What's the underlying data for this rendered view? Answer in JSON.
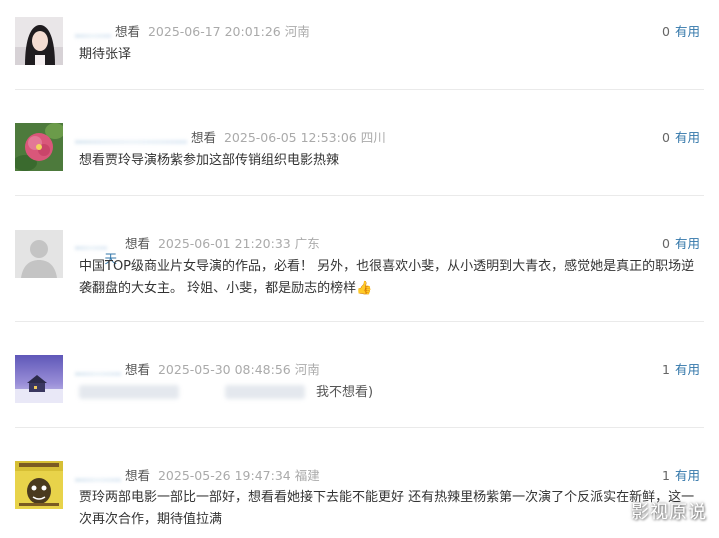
{
  "comments": [
    {
      "username": "",
      "action": "想看",
      "time": "2025-06-17 20:01:26",
      "location": "河南",
      "votes": "0",
      "useful_label": "有用",
      "content": "期待张译"
    },
    {
      "username": "",
      "action": "想看",
      "time": "2025-06-05 12:53:06",
      "location": "四川",
      "votes": "0",
      "useful_label": "有用",
      "content": "想看贾玲导演杨紫参加这部传销组织电影热辣"
    },
    {
      "username": "天",
      "action": "想看",
      "time": "2025-06-01 21:20:33",
      "location": "广东",
      "votes": "0",
      "useful_label": "有用",
      "content": "中国TOP级商业片女导演的作品，必看！ 另外，也很喜欢小斐，从小透明到大青衣，感觉她是真正的职场逆袭翻盘的大女主。 玲姐、小斐，都是励志的榜样👍"
    },
    {
      "username": "",
      "action": "想看",
      "time": "2025-05-30 08:48:56",
      "location": "河南",
      "votes": "1",
      "useful_label": "有用",
      "content": "我不想看)"
    },
    {
      "username": "",
      "action": "想看",
      "time": "2025-05-26 19:47:34",
      "location": "福建",
      "votes": "1",
      "useful_label": "有用",
      "content": "贾玲两部电影一部比一部好，想看看她接下去能不能更好 还有热辣里杨紫第一次演了个反派实在新鲜，这一次再次合作，期待值拉满"
    }
  ],
  "watermark": "影视原说"
}
